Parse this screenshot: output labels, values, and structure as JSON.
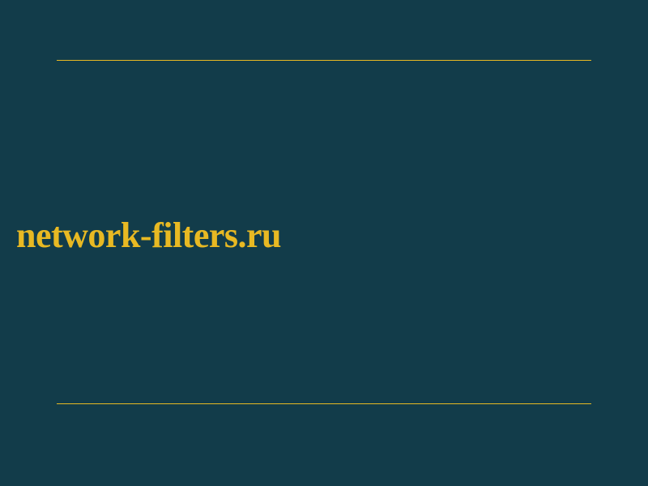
{
  "domain": "network-filters.ru",
  "colors": {
    "background": "#123c4a",
    "accent": "#e8b923"
  }
}
